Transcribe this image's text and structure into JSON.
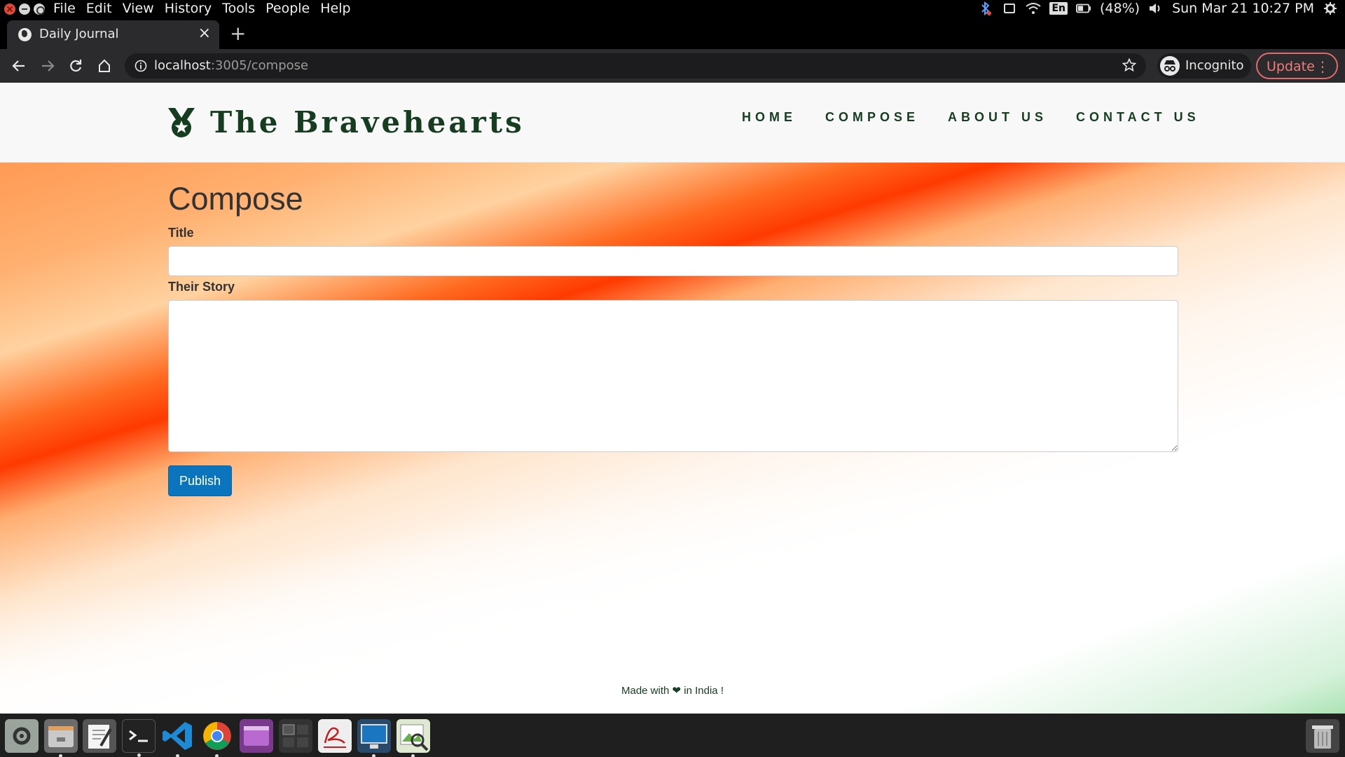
{
  "os_bar": {
    "menu": [
      "File",
      "Edit",
      "View",
      "History",
      "Tools",
      "People",
      "Help"
    ],
    "input_lang": "En",
    "battery": "(48%)",
    "clock": "Sun Mar 21 10:27 PM"
  },
  "browser": {
    "tab_title": "Daily Journal",
    "url_host": "localhost",
    "url_rest": ":3005/compose",
    "incognito_label": "Incognito",
    "update_label": "Update"
  },
  "site": {
    "brand": "The Bravehearts",
    "nav": [
      "HOME",
      "COMPOSE",
      "ABOUT US",
      "CONTACT US"
    ],
    "page_title": "Compose",
    "form": {
      "title_label": "Title",
      "title_value": "",
      "story_label": "Their Story",
      "story_value": "",
      "publish_label": "Publish"
    },
    "footer": {
      "before": "Made with",
      "heart": "❤",
      "after": "in India !"
    }
  },
  "colors": {
    "brand_green": "#163d1f",
    "publish_blue": "#0a74bd",
    "update_red": "#e26a6a"
  },
  "dock_icons": [
    "settings-icon",
    "files-icon",
    "text-editor-icon",
    "terminal-icon",
    "vscode-icon",
    "chrome-icon",
    "media-icon",
    "workspace-icon",
    "pdf-viewer-icon",
    "screenshot-icon",
    "image-viewer-icon",
    "trash-icon"
  ]
}
